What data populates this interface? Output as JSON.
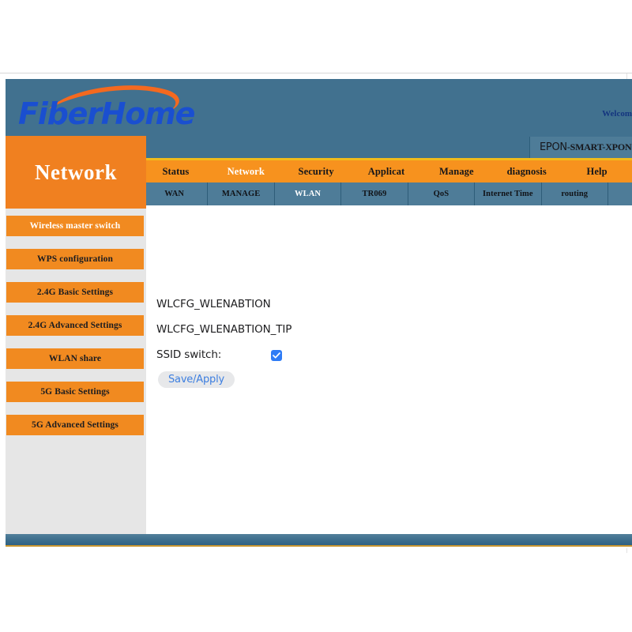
{
  "banner": {
    "logo_text": "FiberHome",
    "logo_swoosh_color": "#f4691f",
    "logo_text_color": "#1a4fd0",
    "welcome_text": "Welcom",
    "device_prefix": "EPON",
    "device_model": "-SMART-XPON",
    "background_color": "#41718f"
  },
  "section": {
    "title": "Network",
    "accent_color": "#f08020"
  },
  "topnav": {
    "items": [
      {
        "label": "Status",
        "active": false
      },
      {
        "label": "Network",
        "active": true
      },
      {
        "label": "Security",
        "active": false
      },
      {
        "label": "Applicat",
        "active": false
      },
      {
        "label": "Manage",
        "active": false
      },
      {
        "label": "diagnosis",
        "active": false
      },
      {
        "label": "Help",
        "active": false
      }
    ],
    "background_color": "#f7921e",
    "top_border_color": "#f0bb1c"
  },
  "subnav": {
    "items": [
      {
        "label": "WAN",
        "active": false
      },
      {
        "label": "MANAGE",
        "active": false
      },
      {
        "label": "WLAN",
        "active": true
      },
      {
        "label": "TR069",
        "active": false
      },
      {
        "label": "QoS",
        "active": false
      },
      {
        "label": "Internet Time",
        "active": false
      },
      {
        "label": "routing",
        "active": false
      }
    ],
    "background_color": "#4e7c98"
  },
  "sidebar": {
    "items": [
      {
        "label": "Wireless master switch",
        "active": true
      },
      {
        "label": "WPS configuration",
        "active": false
      },
      {
        "label": "2.4G Basic Settings",
        "active": false
      },
      {
        "label": "2.4G Advanced Settings",
        "active": false
      },
      {
        "label": "WLAN share",
        "active": false
      },
      {
        "label": "5G Basic Settings",
        "active": false
      },
      {
        "label": "5G Advanced Settings",
        "active": false
      }
    ],
    "background_color": "#e6e6e6",
    "item_color": "#f18a20"
  },
  "content": {
    "heading": "WLCFG_WLENABTION",
    "tip": "WLCFG_WLENABTION_TIP",
    "ssid_switch_label": "SSID switch:",
    "ssid_switch_checked": true,
    "ssid_switch_color": "#2f7cf6",
    "save_label": "Save/Apply",
    "save_text_color": "#3d7fe0",
    "save_background_color": "#e7e8ea"
  },
  "footer": {
    "bar_color": "#3f6f8d",
    "rule_color": "#c8952f"
  }
}
